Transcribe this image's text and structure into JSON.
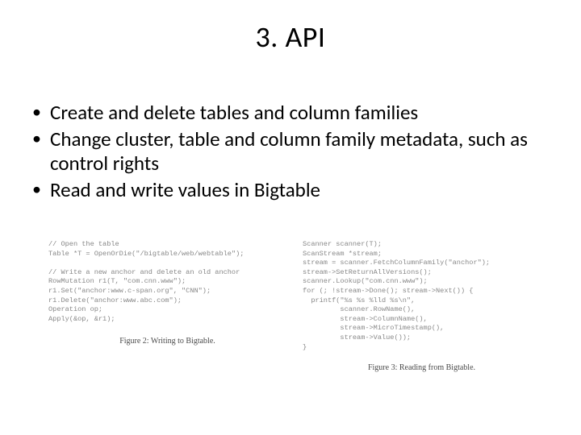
{
  "title": "3. API",
  "bullets": [
    "Create and delete tables and column families",
    "Change cluster, table and column family metadata, such as control rights",
    "Read and write values in Bigtable"
  ],
  "figures": {
    "left": {
      "caption": "Figure 2: Writing to Bigtable.",
      "code": "// Open the table\nTable *T = OpenOrDie(\"/bigtable/web/webtable\");\n\n// Write a new anchor and delete an old anchor\nRowMutation r1(T, \"com.cnn.www\");\nr1.Set(\"anchor:www.c-span.org\", \"CNN\");\nr1.Delete(\"anchor:www.abc.com\");\nOperation op;\nApply(&op, &r1);"
    },
    "right": {
      "caption": "Figure 3: Reading from Bigtable.",
      "code": "Scanner scanner(T);\nScanStream *stream;\nstream = scanner.FetchColumnFamily(\"anchor\");\nstream->SetReturnAllVersions();\nscanner.Lookup(\"com.cnn.www\");\nfor (; !stream->Done(); stream->Next()) {\n  printf(\"%s %s %lld %s\\n\",\n         scanner.RowName(),\n         stream->ColumnName(),\n         stream->MicroTimestamp(),\n         stream->Value());\n}"
    }
  }
}
